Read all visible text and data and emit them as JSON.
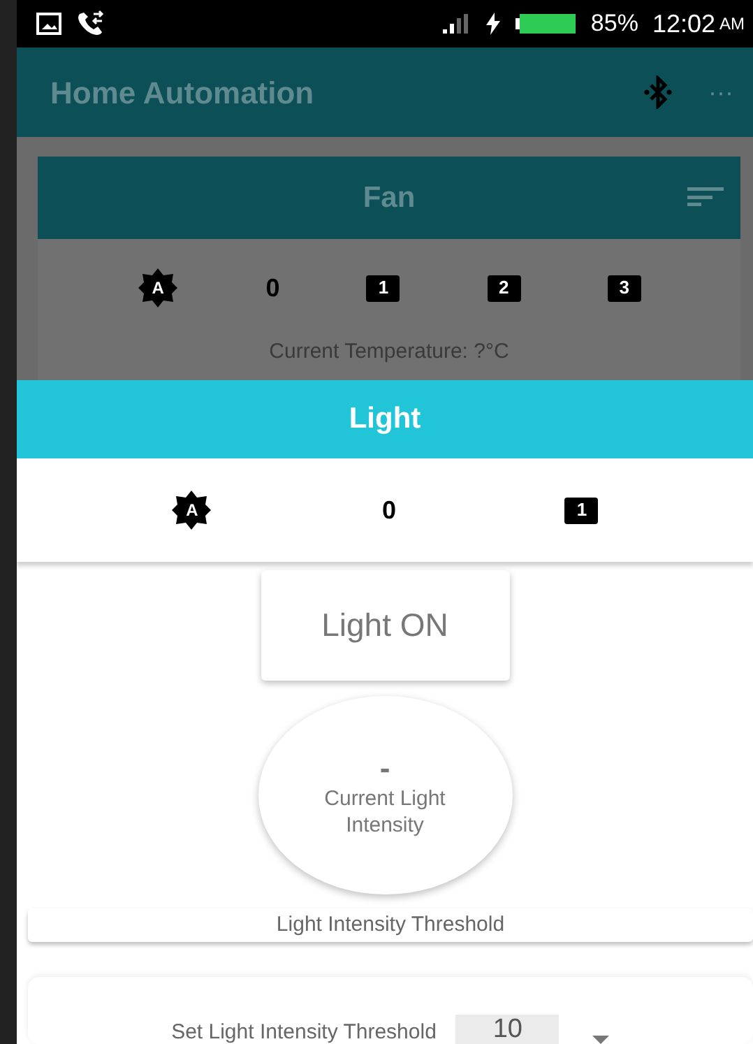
{
  "status_bar": {
    "battery_percent": "85%",
    "time": "12:02",
    "meridiem": "AM"
  },
  "app_bar": {
    "title": "Home Automation",
    "menu": "···"
  },
  "fan": {
    "title": "Fan",
    "modes": [
      {
        "kind": "auto",
        "label": "A"
      },
      {
        "kind": "off",
        "label": "0"
      },
      {
        "kind": "level",
        "label": "1"
      },
      {
        "kind": "level",
        "label": "2"
      },
      {
        "kind": "level",
        "label": "3"
      }
    ],
    "temperature": "Current Temperature: ?°C"
  },
  "light": {
    "title": "Light",
    "modes": [
      {
        "kind": "auto",
        "label": "A"
      },
      {
        "kind": "off",
        "label": "0"
      },
      {
        "kind": "level",
        "label": "1"
      }
    ],
    "toggle_button": "Light ON",
    "intensity_value": "-",
    "intensity_label": "Current Light Intensity",
    "threshold_heading": "Light Intensity Threshold",
    "threshold_setting": {
      "label": "Set Light Intensity Threshold",
      "value": "10"
    }
  }
}
